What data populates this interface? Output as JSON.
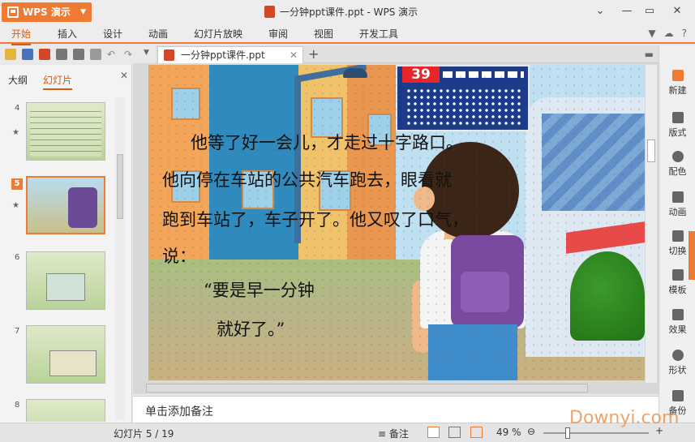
{
  "titlebar": {
    "app_button": "WPS 演示",
    "window_title": "一分钟ppt课件.ppt - WPS 演示",
    "minimize": "—",
    "restore": "▭",
    "close": "✕",
    "dropdown": "⌄"
  },
  "menu": {
    "items": [
      "开始",
      "插入",
      "设计",
      "动画",
      "幻灯片放映",
      "审阅",
      "视图",
      "开发工具"
    ],
    "help": "?"
  },
  "tabs": {
    "doc_tab": "一分钟ppt课件.ppt",
    "close": "✕",
    "add": "+"
  },
  "left_panel": {
    "tab_outline": "大纲",
    "tab_slides": "幻灯片",
    "close": "✕",
    "thumbnails": [
      {
        "num": "4"
      },
      {
        "num": "5"
      },
      {
        "num": "6"
      },
      {
        "num": "7"
      },
      {
        "num": "8"
      }
    ]
  },
  "slide": {
    "sign_number": "39",
    "line1": "他等了好一会儿，才走过十字路口。",
    "line2": "他向停在车站的公共汽车跑去，眼看就",
    "line3": "跑到车站了，车子开了。他又叹了口气，",
    "line4": "说：",
    "line5": "“要是早一分钟",
    "line6": "就好了。”"
  },
  "notes": {
    "placeholder": "单击添加备注"
  },
  "right_sidebar": {
    "items": [
      "新建",
      "版式",
      "配色",
      "动画",
      "切换",
      "模板",
      "效果",
      "形状",
      "备份"
    ]
  },
  "statusbar": {
    "slide_indicator": "幻灯片 5 / 19",
    "notes_button": "备注",
    "zoom": "49 %",
    "zoom_minus": "⊖",
    "zoom_plus": "+"
  },
  "watermark": "Downyi.com",
  "colors": {
    "accent": "#ee7a33"
  }
}
